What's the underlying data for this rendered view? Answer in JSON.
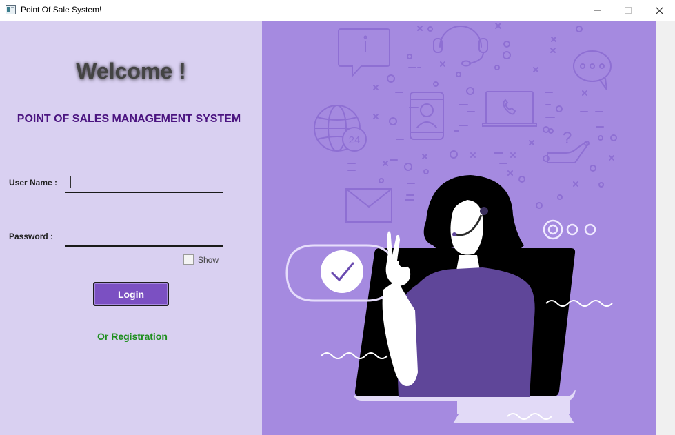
{
  "window": {
    "title": "Point Of Sale System!",
    "controls": [
      "minimize",
      "maximize",
      "close"
    ]
  },
  "login": {
    "welcome": "Welcome !",
    "subtitle": "POINT OF SALES MANAGEMENT SYSTEM",
    "username_label": "User Name :",
    "username_value": "",
    "password_label": "Password :",
    "password_value": "",
    "show_label": "Show",
    "show_checked": false,
    "login_button": "Login",
    "registration_link": "Or Registration"
  },
  "illustration": {
    "icon_names": [
      "info-bubble-icon",
      "headset-icon",
      "chat-bubble-icon",
      "globe-24-icon",
      "phone-person-icon",
      "laptop-call-icon",
      "question-hand-icon",
      "mail-icon",
      "check-icon"
    ],
    "badge": "24",
    "question_mark": "?"
  },
  "colors": {
    "left_panel_bg": "#d9d0f1",
    "right_panel_bg": "#a58ae0",
    "subtitle": "#4b1480",
    "login_button": "#7b50c2",
    "registration_link": "#1e8e1e",
    "agent_shirt": "#5f4699"
  }
}
